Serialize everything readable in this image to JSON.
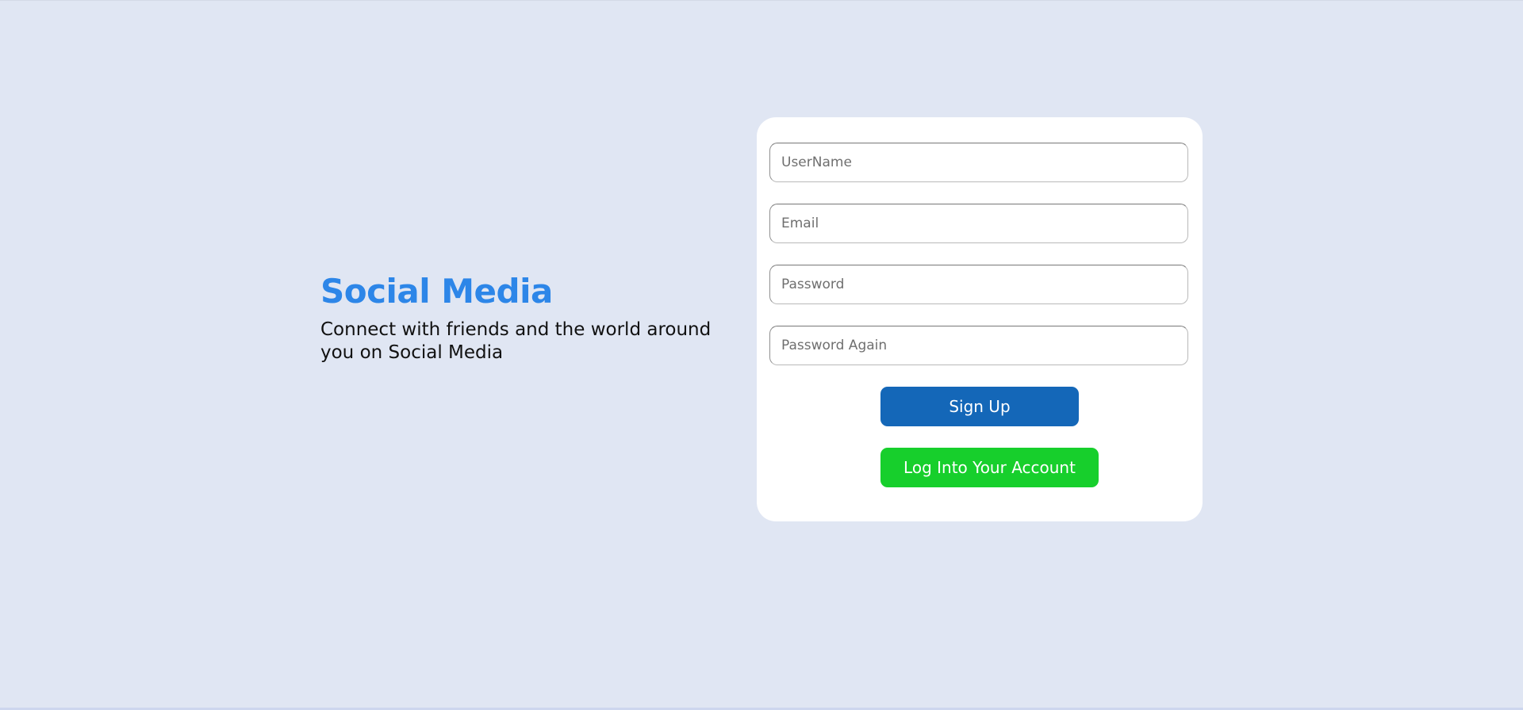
{
  "brand": {
    "title": "Social Media",
    "tagline": "Connect with friends and the world around you on Social Media"
  },
  "form": {
    "username_placeholder": "UserName",
    "email_placeholder": "Email",
    "password_placeholder": "Password",
    "password_again_placeholder": "Password Again",
    "signup_label": "Sign Up",
    "login_label": "Log Into Your Account"
  },
  "colors": {
    "background": "#e0e6f3",
    "brand_title": "#2d86e8",
    "signup_button": "#1467b8",
    "login_button": "#17cf2c",
    "card": "#ffffff"
  }
}
